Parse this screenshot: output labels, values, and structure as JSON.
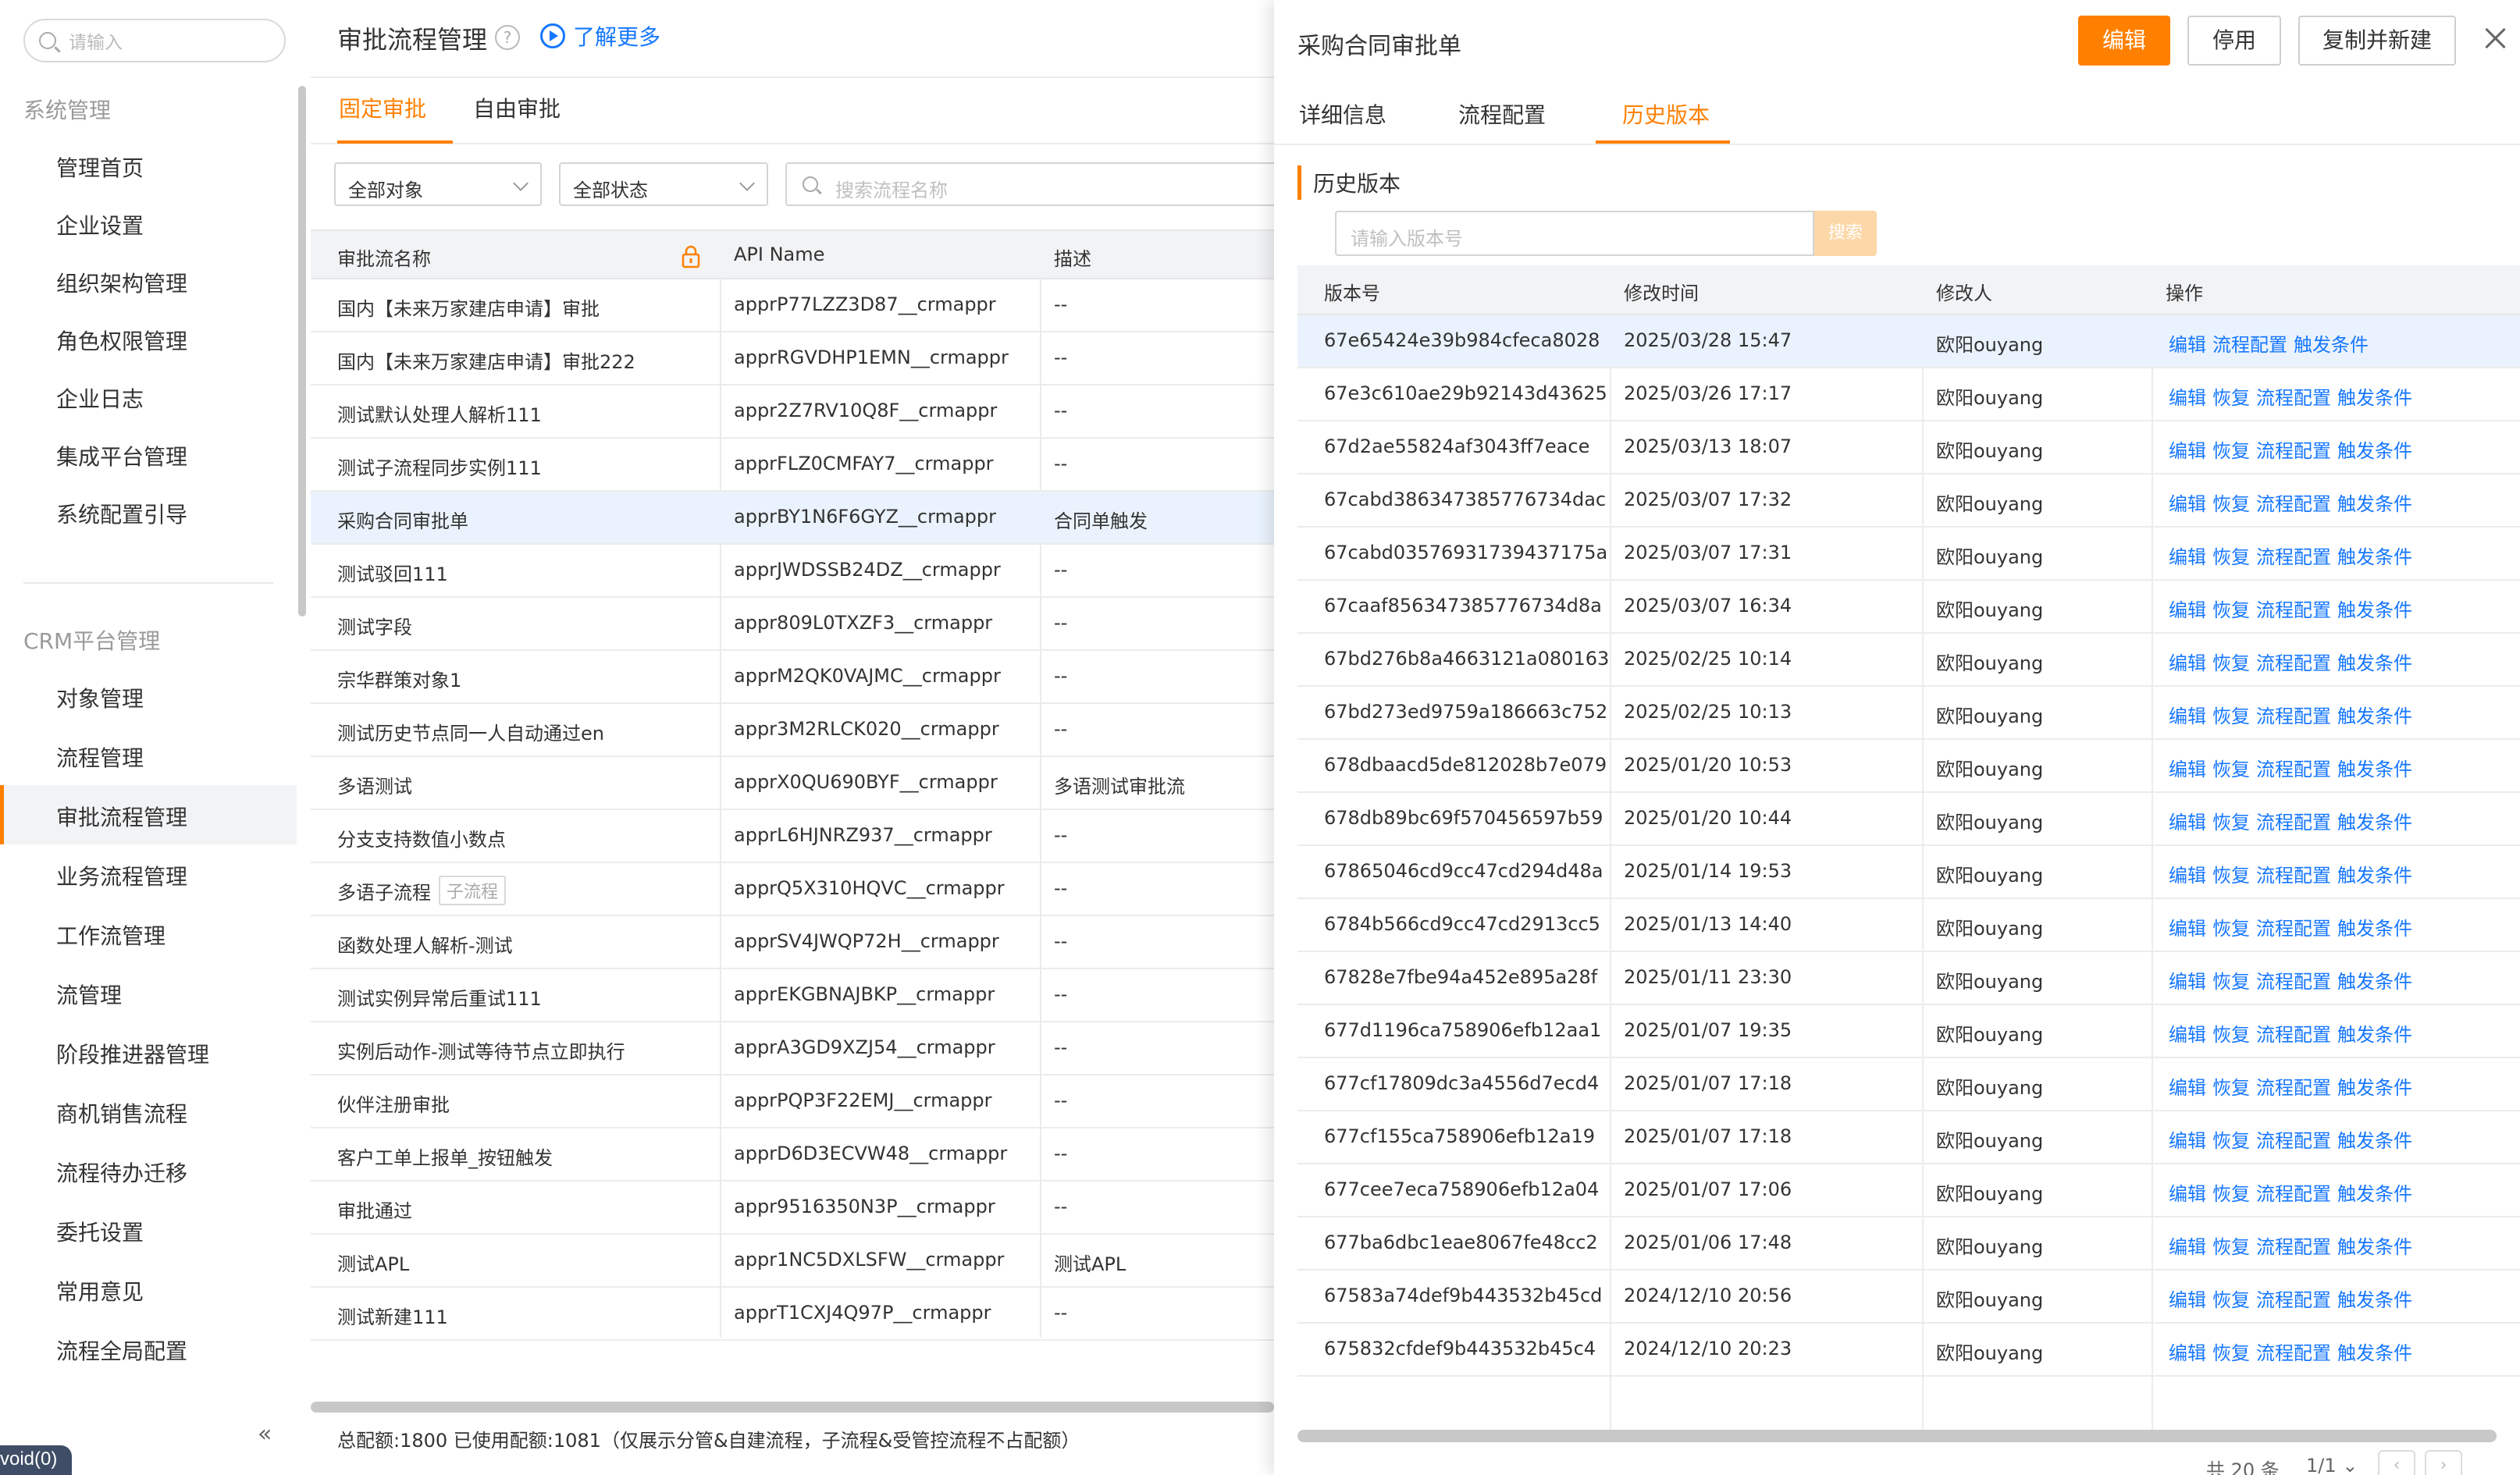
{
  "sidebar": {
    "search_placeholder": "请输入",
    "section_system": "系统管理",
    "system_items": [
      {
        "label": "管理首页",
        "icon": "home-icon"
      },
      {
        "label": "企业设置",
        "icon": "building-icon"
      },
      {
        "label": "组织架构管理",
        "icon": "org-chart-icon"
      },
      {
        "label": "角色权限管理",
        "icon": "id-card-icon"
      },
      {
        "label": "企业日志",
        "icon": "log-icon"
      },
      {
        "label": "集成平台管理",
        "icon": "chip-icon"
      },
      {
        "label": "系统配置引导",
        "icon": "guide-icon"
      }
    ],
    "section_crm": "CRM平台管理",
    "crm_items": [
      {
        "label": "对象管理",
        "icon": "cube-icon"
      },
      {
        "label": "流程管理",
        "icon": "flow-icon"
      }
    ],
    "flow_sub_items": [
      "审批流程管理",
      "业务流程管理",
      "工作流管理",
      "流管理",
      "阶段推进器管理",
      "商机销售流程",
      "流程待办迁移",
      "委托设置",
      "常用意见",
      "流程全局配置"
    ],
    "active_sub": "审批流程管理",
    "collapse": "«",
    "void_tag": "void(0)"
  },
  "middle": {
    "title": "审批流程管理",
    "help": "?",
    "learn_more": "了解更多",
    "tabs": [
      "固定审批",
      "自由审批"
    ],
    "filter_object": "全部对象",
    "filter_status": "全部状态",
    "search_placeholder": "搜索流程名称",
    "columns": [
      "审批流名称",
      "API Name",
      "描述"
    ],
    "rows": [
      {
        "name": "国内【未来万家建店申请】审批",
        "api": "apprP77LZZ3D87__crmappr",
        "desc": "--"
      },
      {
        "name": "国内【未来万家建店申请】审批222",
        "api": "apprRGVDHP1EMN__crmappr",
        "desc": "--"
      },
      {
        "name": "测试默认处理人解析111",
        "api": "appr2Z7RV10Q8F__crmappr",
        "desc": "--"
      },
      {
        "name": "测试子流程同步实例111",
        "api": "apprFLZ0CMFAY7__crmappr",
        "desc": "--"
      },
      {
        "name": "采购合同审批单",
        "api": "apprBY1N6F6GYZ__crmappr",
        "desc": "合同单触发"
      },
      {
        "name": "测试驳回111",
        "api": "apprJWDSSB24DZ__crmappr",
        "desc": "--"
      },
      {
        "name": "测试字段",
        "api": "appr809L0TXZF3__crmappr",
        "desc": "--"
      },
      {
        "name": "宗华群策对象1",
        "api": "apprM2QK0VAJMC__crmappr",
        "desc": "--"
      },
      {
        "name": "测试历史节点同一人自动通过en",
        "api": "appr3M2RLCK020__crmappr",
        "desc": "--"
      },
      {
        "name": "多语测试",
        "api": "apprX0QU690BYF__crmappr",
        "desc": "多语测试审批流"
      },
      {
        "name": "分支支持数值小数点",
        "api": "apprL6HJNRZ937__crmappr",
        "desc": "--"
      },
      {
        "name": "多语子流程",
        "tag": "子流程",
        "api": "apprQ5X310HQVC__crmappr",
        "desc": "--"
      },
      {
        "name": "函数处理人解析-测试",
        "api": "apprSV4JWQP72H__crmappr",
        "desc": "--"
      },
      {
        "name": "测试实例异常后重试111",
        "api": "apprEKGBNAJBKP__crmappr",
        "desc": "--"
      },
      {
        "name": "实例后动作-测试等待节点立即执行",
        "api": "apprA3GD9XZJ54__crmappr",
        "desc": "--"
      },
      {
        "name": "伙伴注册审批",
        "api": "apprPQP3F22EMJ__crmappr",
        "desc": "--"
      },
      {
        "name": "客户工单上报单_按钮触发",
        "api": "apprD6D3ECVW48__crmappr",
        "desc": "--"
      },
      {
        "name": "审批通过",
        "api": "appr9516350N3P__crmappr",
        "desc": "--"
      },
      {
        "name": "测试APL",
        "api": "appr1NC5DXLSFW__crmappr",
        "desc": "测试APL"
      },
      {
        "name": "测试新建111",
        "api": "apprT1CXJ4Q97P__crmappr",
        "desc": "--"
      }
    ],
    "highlighted_row": 4,
    "footer": "总配额:1800 已使用配额:1081（仅展示分管&自建流程，子流程&受管控流程不占配额）"
  },
  "drawer": {
    "title": "采购合同审批单",
    "btn_edit": "编辑",
    "btn_disable": "停用",
    "btn_copy": "复制并新建",
    "tabs": [
      "详细信息",
      "流程配置",
      "历史版本"
    ],
    "active_tab": "历史版本",
    "section_title": "历史版本",
    "version_placeholder": "请输入版本号",
    "search_btn": "搜索",
    "columns": [
      "版本号",
      "修改时间",
      "修改人",
      "操作"
    ],
    "ops_first": [
      "编辑",
      "流程配置",
      "触发条件"
    ],
    "ops": [
      "编辑",
      "恢复",
      "流程配置",
      "触发条件"
    ],
    "rows": [
      {
        "ver": "67e65424e39b984cfeca8028",
        "time": "2025/03/28 15:47",
        "user": "欧阳ouyang"
      },
      {
        "ver": "67e3c610ae29b92143d43625",
        "time": "2025/03/26 17:17",
        "user": "欧阳ouyang"
      },
      {
        "ver": "67d2ae55824af3043ff7eace",
        "time": "2025/03/13 18:07",
        "user": "欧阳ouyang"
      },
      {
        "ver": "67cabd386347385776734dac",
        "time": "2025/03/07 17:32",
        "user": "欧阳ouyang"
      },
      {
        "ver": "67cabd03576931739437175a",
        "time": "2025/03/07 17:31",
        "user": "欧阳ouyang"
      },
      {
        "ver": "67caaf856347385776734d8a",
        "time": "2025/03/07 16:34",
        "user": "欧阳ouyang"
      },
      {
        "ver": "67bd276b8a4663121a080163",
        "time": "2025/02/25 10:14",
        "user": "欧阳ouyang"
      },
      {
        "ver": "67bd273ed9759a186663c752",
        "time": "2025/02/25 10:13",
        "user": "欧阳ouyang"
      },
      {
        "ver": "678dbaacd5de812028b7e079",
        "time": "2025/01/20 10:53",
        "user": "欧阳ouyang"
      },
      {
        "ver": "678db89bc69f570456597b59",
        "time": "2025/01/20 10:44",
        "user": "欧阳ouyang"
      },
      {
        "ver": "67865046cd9cc47cd294d48a",
        "time": "2025/01/14 19:53",
        "user": "欧阳ouyang"
      },
      {
        "ver": "6784b566cd9cc47cd2913cc5",
        "time": "2025/01/13 14:40",
        "user": "欧阳ouyang"
      },
      {
        "ver": "67828e7fbe94a452e895a28f",
        "time": "2025/01/11 23:30",
        "user": "欧阳ouyang"
      },
      {
        "ver": "677d1196ca758906efb12aa1",
        "time": "2025/01/07 19:35",
        "user": "欧阳ouyang"
      },
      {
        "ver": "677cf17809dc3a4556d7ecd4",
        "time": "2025/01/07 17:18",
        "user": "欧阳ouyang"
      },
      {
        "ver": "677cf155ca758906efb12a19",
        "time": "2025/01/07 17:18",
        "user": "欧阳ouyang"
      },
      {
        "ver": "677cee7eca758906efb12a04",
        "time": "2025/01/07 17:06",
        "user": "欧阳ouyang"
      },
      {
        "ver": "677ba6dbc1eae8067fe48cc2",
        "time": "2025/01/06 17:48",
        "user": "欧阳ouyang"
      },
      {
        "ver": "67583a74def9b443532b45cd",
        "time": "2024/12/10 20:56",
        "user": "欧阳ouyang"
      },
      {
        "ver": "675832cfdef9b443532b45c4",
        "time": "2024/12/10 20:23",
        "user": "欧阳ouyang"
      }
    ],
    "total": "共 20 条",
    "page": "1/1",
    "prev": "‹",
    "next": "›"
  },
  "colors": {
    "accent": "#ff8000",
    "link": "#1677ff",
    "row_highlight": "#eaf3fd"
  }
}
